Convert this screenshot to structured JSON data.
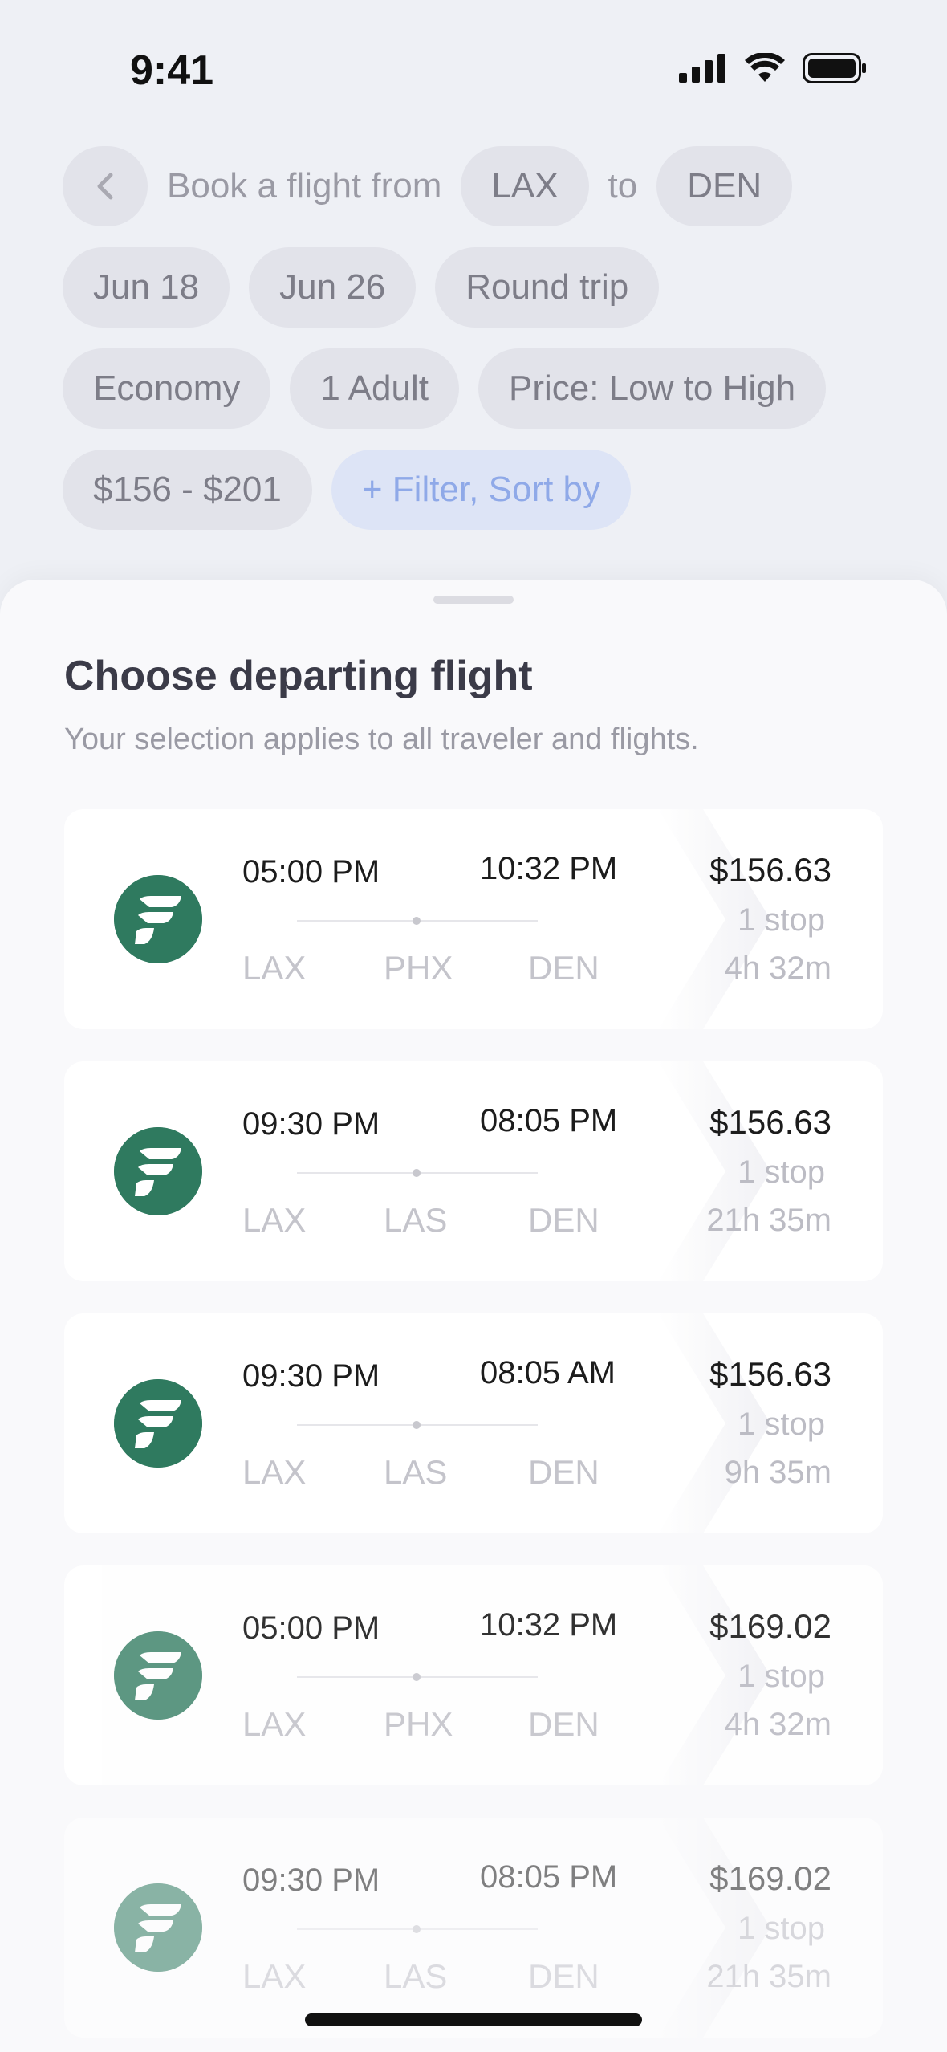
{
  "status": {
    "time": "9:41",
    "icons": [
      "signal-icon",
      "wifi-icon",
      "battery-icon"
    ]
  },
  "search": {
    "prefix": "Book a flight from",
    "from": "LAX",
    "connector": "to",
    "to": "DEN",
    "depart_date": "Jun 18",
    "return_date": "Jun 26",
    "trip_type": "Round trip",
    "cabin": "Economy",
    "travelers": "1 Adult",
    "sort": "Price: Low to High",
    "price_range": "$156 - $201",
    "filter_label": "+ Filter, Sort by"
  },
  "sheet": {
    "title": "Choose departing flight",
    "subtitle": "Your selection applies to all traveler and flights."
  },
  "flights": [
    {
      "depart": "05:00 PM",
      "arrive": "10:32 PM",
      "origin": "LAX",
      "via": "PHX",
      "dest": "DEN",
      "price": "$156.63",
      "stops": "1 stop",
      "duration": "4h 32m"
    },
    {
      "depart": "09:30 PM",
      "arrive": "08:05 PM",
      "origin": "LAX",
      "via": "LAS",
      "dest": "DEN",
      "price": "$156.63",
      "stops": "1 stop",
      "duration": "21h 35m"
    },
    {
      "depart": "09:30 PM",
      "arrive": "08:05 AM",
      "origin": "LAX",
      "via": "LAS",
      "dest": "DEN",
      "price": "$156.63",
      "stops": "1 stop",
      "duration": "9h 35m"
    },
    {
      "depart": "05:00 PM",
      "arrive": "10:32 PM",
      "origin": "LAX",
      "via": "PHX",
      "dest": "DEN",
      "price": "$169.02",
      "stops": "1 stop",
      "duration": "4h 32m"
    },
    {
      "depart": "09:30 PM",
      "arrive": "08:05 PM",
      "origin": "LAX",
      "via": "LAS",
      "dest": "DEN",
      "price": "$169.02",
      "stops": "1 stop",
      "duration": "21h 35m"
    }
  ],
  "colors": {
    "brand": "#2f7a5f",
    "chip": "#e2e3ea",
    "filter_chip": "#dde4f6",
    "filter_text": "#8fa9e8"
  }
}
